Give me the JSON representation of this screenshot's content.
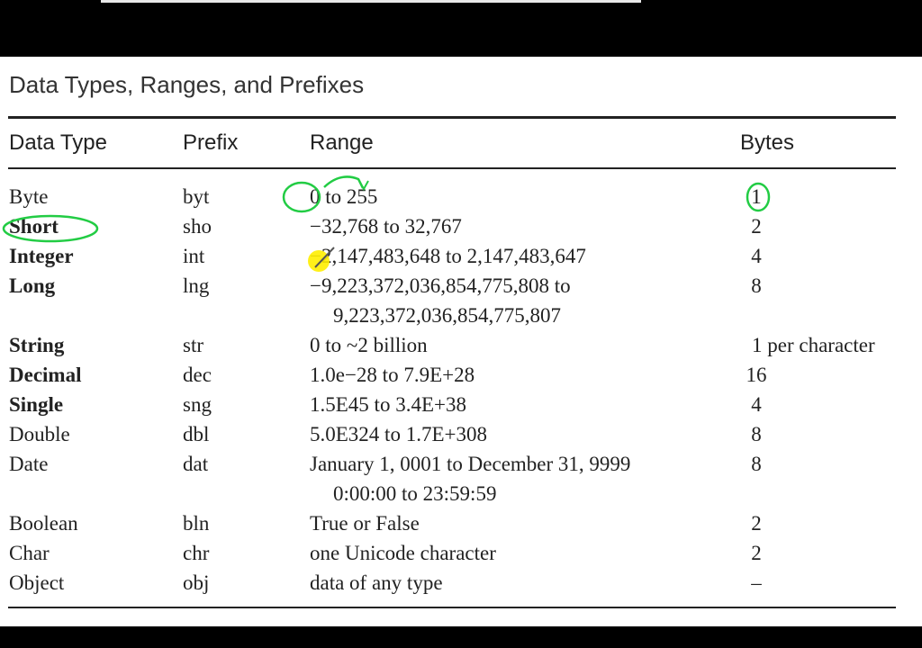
{
  "title": "Data Types, Ranges, and Prefixes",
  "headers": {
    "type": "Data Type",
    "prefix": "Prefix",
    "range": "Range",
    "bytes": "Bytes"
  },
  "rows": [
    {
      "type": "Byte",
      "prefix": "byt",
      "range": "0 to 255",
      "bytes": "1",
      "bold": false
    },
    {
      "type": "Short",
      "prefix": "sho",
      "range": "−32,768 to 32,767",
      "bytes": "2",
      "bold": true
    },
    {
      "type": "Integer",
      "prefix": "int",
      "range": "−2,147,483,648 to 2,147,483,647",
      "bytes": "4",
      "bold": true
    },
    {
      "type": "Long",
      "prefix": "lng",
      "range": "−9,223,372,036,854,775,808 to",
      "range2": "9,223,372,036,854,775,807",
      "bytes": "8",
      "bold": true
    },
    {
      "type": "String",
      "prefix": "str",
      "range": "0 to ~2 billion",
      "bytes": "1 per character",
      "bold": true
    },
    {
      "type": "Decimal",
      "prefix": "dec",
      "range": "1.0e−28 to 7.9E+28",
      "bytes": "16",
      "bold": true
    },
    {
      "type": "Single",
      "prefix": "sng",
      "range": "1.5E45 to 3.4E+38",
      "bytes": "4",
      "bold": true
    },
    {
      "type": "Double",
      "prefix": "dbl",
      "range": "5.0E324 to 1.7E+308",
      "bytes": "8",
      "bold": false
    },
    {
      "type": "Date",
      "prefix": "dat",
      "range": "January 1, 0001 to December 31, 9999",
      "range2": "0:00:00 to 23:59:59",
      "bytes": "8",
      "bold": false
    },
    {
      "type": "Boolean",
      "prefix": "bln",
      "range": "True or False",
      "bytes": "2",
      "bold": false
    },
    {
      "type": "Char",
      "prefix": "chr",
      "range": "one Unicode character",
      "bytes": "2",
      "bold": false
    },
    {
      "type": "Object",
      "prefix": "obj",
      "range": "data of any type",
      "bytes": "–",
      "bold": false
    }
  ],
  "colors": {
    "annotation": "#22cc44",
    "pointer": "#ffee00"
  }
}
